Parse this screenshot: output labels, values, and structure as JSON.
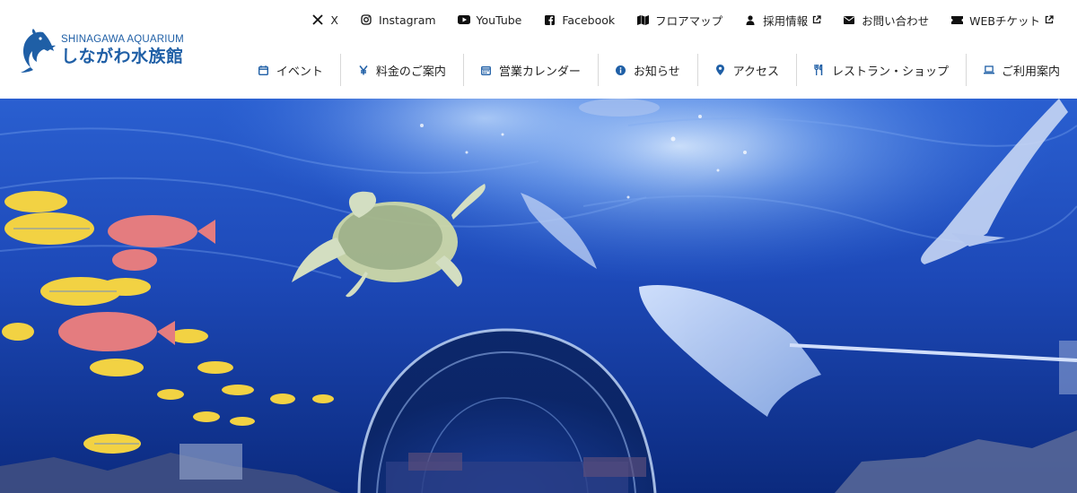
{
  "logo": {
    "en": "SHINAGAWA AQUARIUM",
    "ja": "しながわ水族館",
    "icon": "dolphin-logo-icon"
  },
  "top_links": [
    {
      "label": "X",
      "icon": "x-icon",
      "external": false
    },
    {
      "label": "Instagram",
      "icon": "instagram-icon",
      "external": false
    },
    {
      "label": "YouTube",
      "icon": "youtube-icon",
      "external": false
    },
    {
      "label": "Facebook",
      "icon": "facebook-icon",
      "external": false
    },
    {
      "label": "フロアマップ",
      "icon": "map-icon",
      "external": false
    },
    {
      "label": "採用情報",
      "icon": "person-icon",
      "external": true
    },
    {
      "label": "お問い合わせ",
      "icon": "mail-icon",
      "external": false
    },
    {
      "label": "WEBチケット",
      "icon": "ticket-icon",
      "external": true
    }
  ],
  "nav": [
    {
      "label": "イベント",
      "icon": "calendar-icon"
    },
    {
      "label": "料金のご案内",
      "icon": "yen-icon"
    },
    {
      "label": "営業カレンダー",
      "icon": "calendar-grid-icon"
    },
    {
      "label": "お知らせ",
      "icon": "info-icon"
    },
    {
      "label": "アクセス",
      "icon": "location-pin-icon"
    },
    {
      "label": "レストラン・ショップ",
      "icon": "restaurant-icon"
    },
    {
      "label": "ご利用案内",
      "icon": "laptop-icon"
    }
  ],
  "colors": {
    "brand": "#1f5fa6",
    "water_deep": "#0a2a7a",
    "water_light": "#3f7fe0"
  },
  "hero": {
    "image": "underwater tunnel"
  }
}
